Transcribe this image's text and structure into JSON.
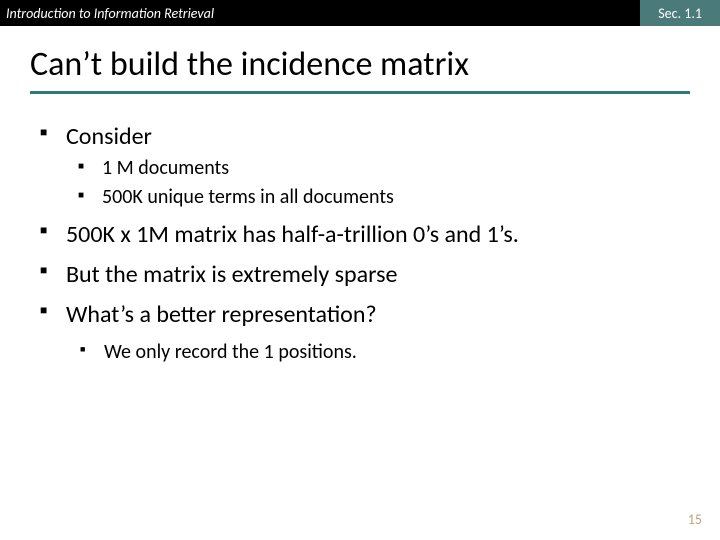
{
  "header": {
    "course": "Introduction to Information Retrieval",
    "section": "Sec. 1.1"
  },
  "title": "Can’t build the incidence matrix",
  "bullets": {
    "b1": "Consider",
    "b1a": "1 M documents",
    "b1b": "500K unique terms in all documents",
    "b2": "500K x 1M matrix has half-a-trillion 0’s and 1’s.",
    "b3": "But the matrix is extremely sparse",
    "b4": "What’s a better representation?",
    "b4a": "We only record the 1 positions."
  },
  "page_number": "15"
}
